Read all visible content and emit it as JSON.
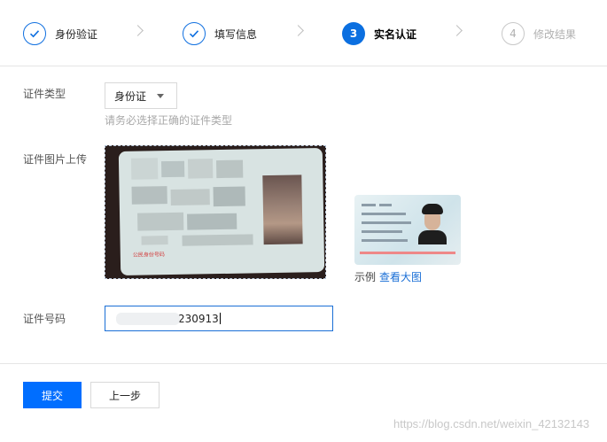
{
  "steps": [
    {
      "label": "身份验证",
      "state": "done"
    },
    {
      "label": "填写信息",
      "state": "done"
    },
    {
      "number": "3",
      "label": "实名认证",
      "state": "active"
    },
    {
      "number": "4",
      "label": "修改结果",
      "state": "todo"
    }
  ],
  "form": {
    "id_type": {
      "label": "证件类型",
      "value": "身份证",
      "hint": "请务必选择正确的证件类型"
    },
    "id_image": {
      "label": "证件图片上传",
      "card_text": "公民身份号码"
    },
    "sample": {
      "caption": "示例",
      "link": "查看大图"
    },
    "id_number": {
      "label": "证件号码",
      "visible_value": "230913"
    }
  },
  "buttons": {
    "submit": "提交",
    "back": "上一步"
  },
  "watermark": "https://blog.csdn.net/weixin_42132143",
  "colors": {
    "primary": "#006eff",
    "link": "#1a6fd6",
    "step_active": "#0b6fe0"
  }
}
